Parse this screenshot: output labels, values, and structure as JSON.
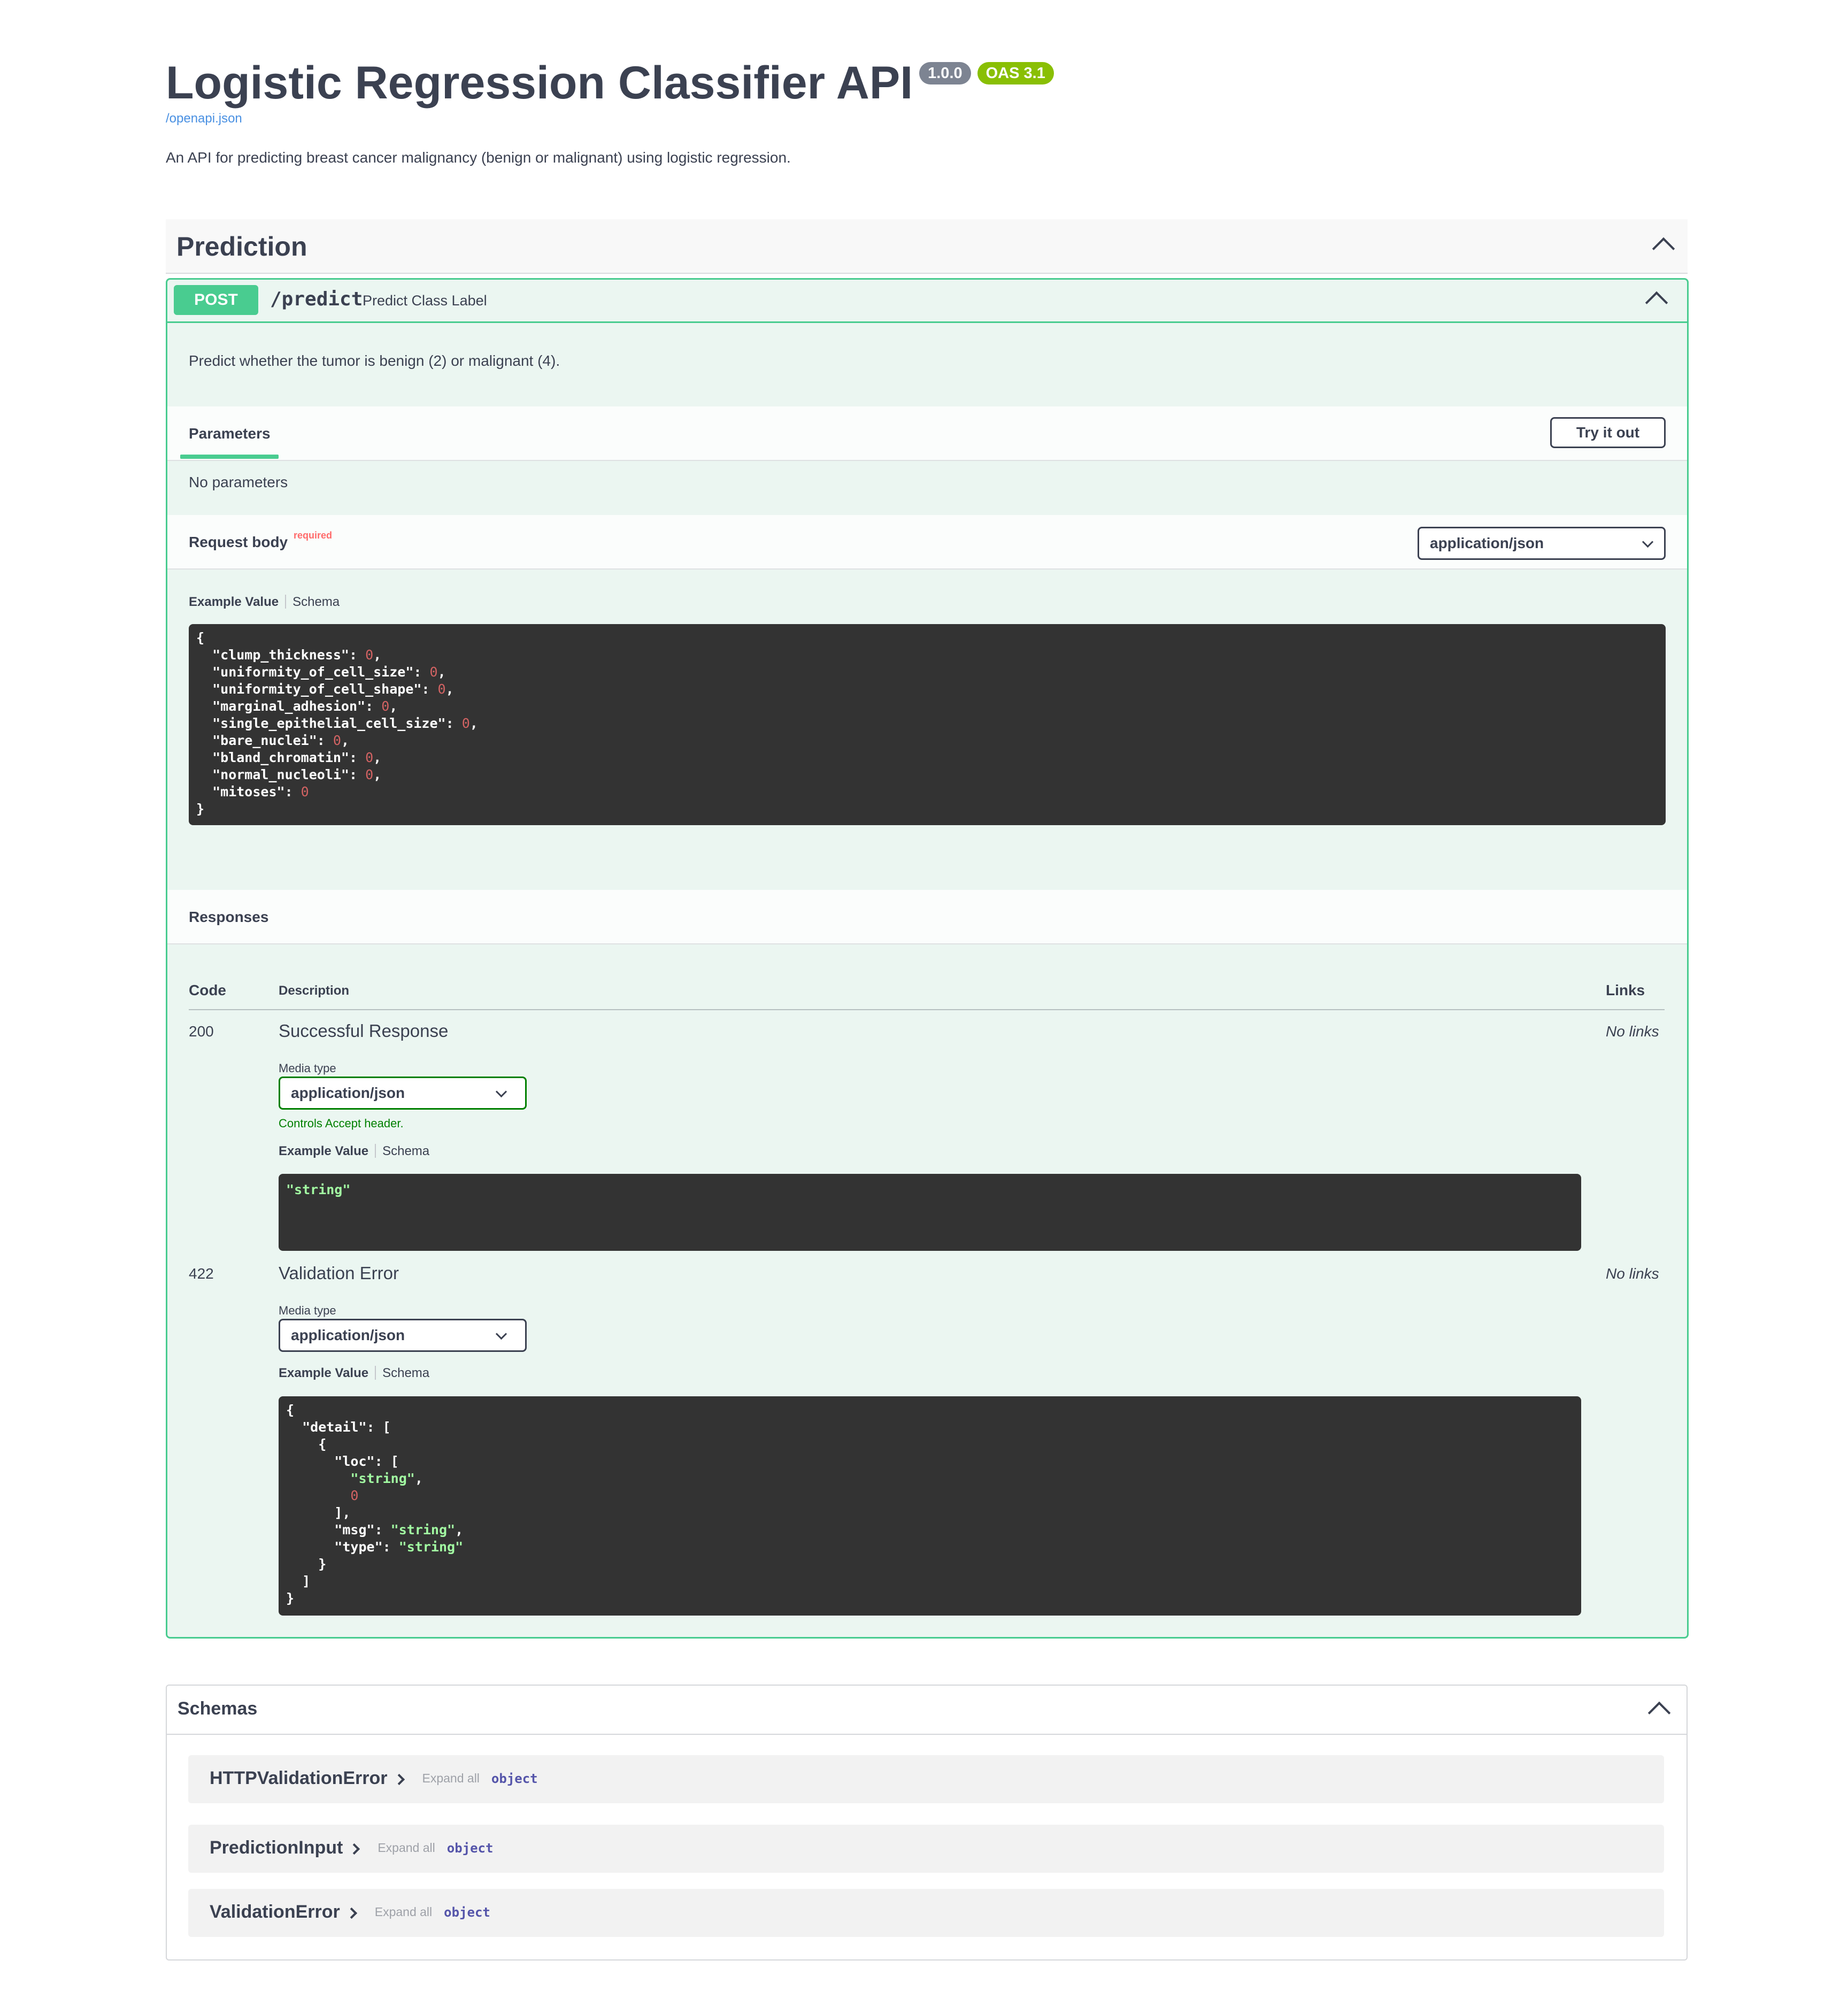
{
  "info": {
    "title": "Logistic Regression Classifier API",
    "version_badge": "1.0.0",
    "oas_badge": "OAS 3.1",
    "spec_link": "/openapi.json",
    "description": "An API for predicting breast cancer malignancy (benign or malignant) using logistic regression."
  },
  "tag": {
    "name": "Prediction",
    "icon": "chevron-up-icon"
  },
  "operation": {
    "method": "POST",
    "path": "/predict",
    "summary": "Predict Class Label",
    "description": "Predict whether the tumor is benign (2) or malignant (4).",
    "parameters": {
      "tab_label": "Parameters",
      "try_button": "Try it out",
      "empty_text": "No parameters"
    },
    "request_body": {
      "label": "Request body",
      "required_flag": "required",
      "content_type": "application/json",
      "tab_example": "Example Value",
      "tab_schema": "Schema",
      "example_fields": [
        {
          "key": "clump_thickness",
          "value": 0
        },
        {
          "key": "uniformity_of_cell_size",
          "value": 0
        },
        {
          "key": "uniformity_of_cell_shape",
          "value": 0
        },
        {
          "key": "marginal_adhesion",
          "value": 0
        },
        {
          "key": "single_epithelial_cell_size",
          "value": 0
        },
        {
          "key": "bare_nuclei",
          "value": 0
        },
        {
          "key": "bland_chromatin",
          "value": 0
        },
        {
          "key": "normal_nucleoli",
          "value": 0
        },
        {
          "key": "mitoses",
          "value": 0
        }
      ]
    },
    "responses": {
      "label": "Responses",
      "col_code": "Code",
      "col_description": "Description",
      "col_links": "Links",
      "items": [
        {
          "code": "200",
          "description": "Successful Response",
          "media_type_label": "Media type",
          "media_type": "application/json",
          "accept_note": "Controls Accept header.",
          "tab_example": "Example Value",
          "tab_schema": "Schema",
          "example": "\"string\"",
          "links": "No links"
        },
        {
          "code": "422",
          "description": "Validation Error",
          "media_type_label": "Media type",
          "media_type": "application/json",
          "tab_example": "Example Value",
          "tab_schema": "Schema",
          "example_lines": [
            {
              "text": "{"
            },
            {
              "text": "  \"detail\": ["
            },
            {
              "text": "    {"
            },
            {
              "text": "      \"loc\": ["
            },
            {
              "text": "        \"string\",",
              "kind": "str"
            },
            {
              "text": "        0",
              "kind": "num"
            },
            {
              "text": "      ],"
            },
            {
              "text": "      \"msg\": \"string\",",
              "kind": "mixed"
            },
            {
              "text": "      \"type\": \"string\"",
              "kind": "mixed"
            },
            {
              "text": "    }"
            },
            {
              "text": "  ]"
            },
            {
              "text": "}"
            }
          ],
          "links": "No links"
        }
      ]
    }
  },
  "schemas": {
    "title": "Schemas",
    "items": [
      {
        "name": "HTTPValidationError",
        "expand": "Expand all",
        "type": "object"
      },
      {
        "name": "PredictionInput",
        "expand": "Expand all",
        "type": "object"
      },
      {
        "name": "ValidationError",
        "expand": "Expand all",
        "type": "object"
      }
    ]
  },
  "colors": {
    "post_green": "#49cc90",
    "op_background": "#ebf6f1",
    "version_badge": "#7d8492",
    "oas_badge": "#89bf04",
    "code_background": "#333333",
    "required_red": "#ff6b6b"
  }
}
